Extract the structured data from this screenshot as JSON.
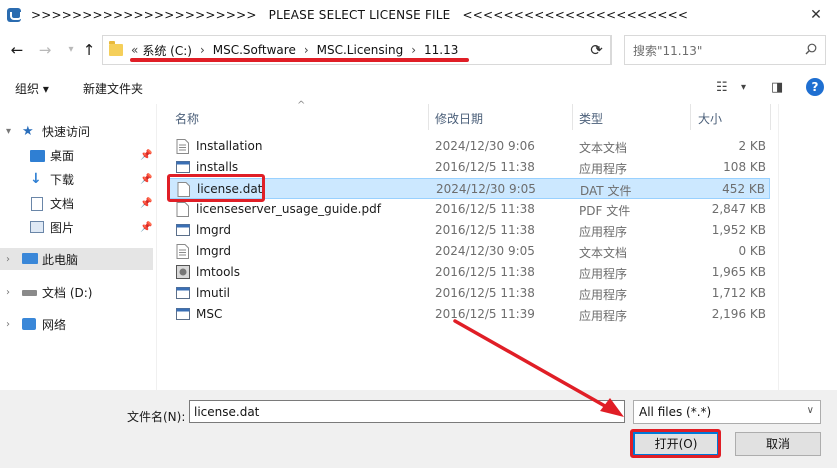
{
  "window": {
    "title": ">>>>>>>>>>>>>>>>>>>>>>   PLEASE SELECT LICENSE FILE   <<<<<<<<<<<<<<<<<<<<<<"
  },
  "navigation": {
    "breadcrumb": [
      "系统 (C:)",
      "MSC.Software",
      "MSC.Licensing",
      "11.13"
    ],
    "overflow_marker": "«",
    "search_placeholder": "搜索\"11.13\""
  },
  "toolbar": {
    "organize_label": "组织",
    "new_folder_label": "新建文件夹"
  },
  "sidebar": {
    "quick_access": "快速访问",
    "items": [
      {
        "label": "桌面",
        "icon": "desktop-icon"
      },
      {
        "label": "下载",
        "icon": "download-icon"
      },
      {
        "label": "文档",
        "icon": "documents-icon"
      },
      {
        "label": "图片",
        "icon": "pictures-icon"
      }
    ],
    "this_pc": "此电脑",
    "drive": "文档 (D:)",
    "network": "网络"
  },
  "file_list": {
    "columns": {
      "name": "名称",
      "date": "修改日期",
      "type": "类型",
      "size": "大小"
    },
    "rows": [
      {
        "name": "Installation",
        "date": "2024/12/30 9:06",
        "type": "文本文档",
        "size": "2 KB",
        "icon": "text-file-icon"
      },
      {
        "name": "installs",
        "date": "2016/12/5 11:38",
        "type": "应用程序",
        "size": "108 KB",
        "icon": "app-icon"
      },
      {
        "name": "license.dat",
        "date": "2024/12/30 9:05",
        "type": "DAT 文件",
        "size": "452 KB",
        "icon": "blank-file-icon",
        "selected": true
      },
      {
        "name": "licenseserver_usage_guide.pdf",
        "date": "2016/12/5 11:38",
        "type": "PDF 文件",
        "size": "2,847 KB",
        "icon": "blank-file-icon"
      },
      {
        "name": "lmgrd",
        "date": "2016/12/5 11:38",
        "type": "应用程序",
        "size": "1,952 KB",
        "icon": "app-icon"
      },
      {
        "name": "lmgrd",
        "date": "2024/12/30 9:05",
        "type": "文本文档",
        "size": "0 KB",
        "icon": "text-file-icon"
      },
      {
        "name": "lmtools",
        "date": "2016/12/5 11:38",
        "type": "应用程序",
        "size": "1,965 KB",
        "icon": "tools-app-icon"
      },
      {
        "name": "lmutil",
        "date": "2016/12/5 11:38",
        "type": "应用程序",
        "size": "1,712 KB",
        "icon": "app-icon"
      },
      {
        "name": "MSC",
        "date": "2016/12/5 11:39",
        "type": "应用程序",
        "size": "2,196 KB",
        "icon": "app-icon"
      }
    ]
  },
  "footer": {
    "filename_label": "文件名(N):",
    "filename_value": "license.dat",
    "filter_value": "All files (*.*)",
    "open_label": "打开(O)",
    "cancel_label": "取消"
  },
  "colors": {
    "annotation_red": "#e01e26",
    "selection": "#cce8ff",
    "accent": "#0078d7"
  }
}
